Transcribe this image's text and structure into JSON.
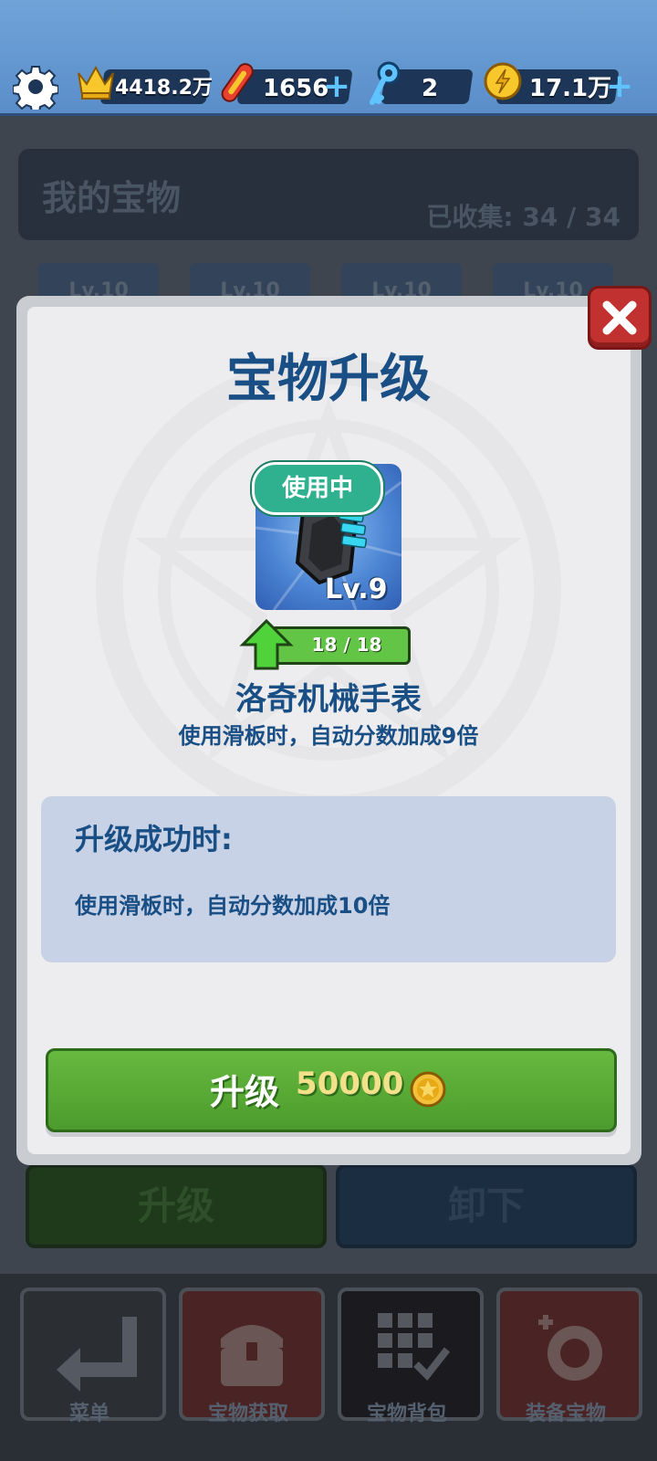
{
  "topbar": {
    "crowns": "4418.2万",
    "boards": "1656",
    "keys": "2",
    "coins": "17.1万"
  },
  "collection": {
    "title": "我的宝物",
    "count": "已收集: 34 / 34",
    "slot_level": "Lv.10"
  },
  "modal": {
    "title": "宝物升级",
    "in_use_badge": "使用中",
    "item_level": "Lv.9",
    "progress_text": "18 / 18",
    "progress_fraction": 1.0,
    "item_name": "洛奇机械手表",
    "item_desc": "使用滑板时，自动分数加成9倍",
    "success_title": "升级成功时:",
    "success_desc": "使用滑板时，自动分数加成10倍",
    "upgrade_label": "升级",
    "upgrade_cost": "50000"
  },
  "background_buttons": {
    "upgrade": "升级",
    "unequip": "卸下"
  },
  "bottom_nav": [
    {
      "label": "菜单",
      "icon": "return-arrow-icon"
    },
    {
      "label": "宝物获取",
      "icon": "treasure-chest-icon"
    },
    {
      "label": "宝物背包",
      "icon": "grid-check-icon"
    },
    {
      "label": "装备宝物",
      "icon": "equip-treasure-icon"
    }
  ],
  "colors": {
    "accent_blue": "#1a4f85",
    "upgrade_green": "#5aaa36",
    "close_red": "#c0312f",
    "badge_teal": "#2fb08e"
  }
}
